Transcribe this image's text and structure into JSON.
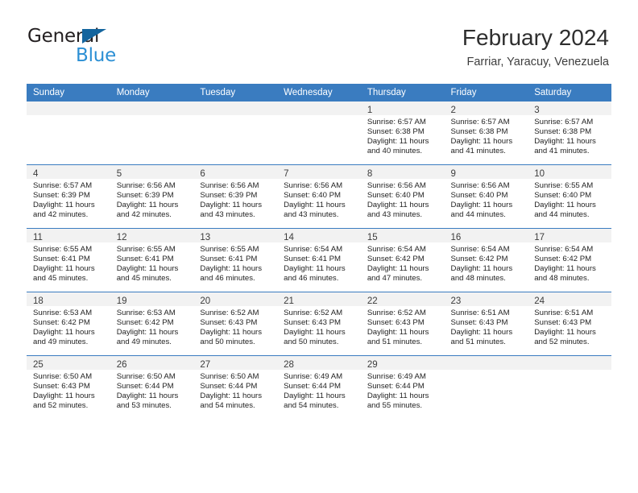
{
  "brand": {
    "line1": "General",
    "line2": "Blue",
    "triangle_color": "#14659e",
    "line2_color": "#2b8fd4"
  },
  "header": {
    "title": "February 2024",
    "location": "Farriar, Yaracuy, Venezuela"
  },
  "theme": {
    "header_row_bg": "#3a7cc0",
    "daynum_band_bg": "#f2f2f2",
    "week_separator": "#3a7cc0"
  },
  "weekdays": [
    "Sunday",
    "Monday",
    "Tuesday",
    "Wednesday",
    "Thursday",
    "Friday",
    "Saturday"
  ],
  "weeks": [
    [
      {
        "day": ""
      },
      {
        "day": ""
      },
      {
        "day": ""
      },
      {
        "day": ""
      },
      {
        "day": "1",
        "sunrise": "Sunrise: 6:57 AM",
        "sunset": "Sunset: 6:38 PM",
        "daylight1": "Daylight: 11 hours",
        "daylight2": "and 40 minutes."
      },
      {
        "day": "2",
        "sunrise": "Sunrise: 6:57 AM",
        "sunset": "Sunset: 6:38 PM",
        "daylight1": "Daylight: 11 hours",
        "daylight2": "and 41 minutes."
      },
      {
        "day": "3",
        "sunrise": "Sunrise: 6:57 AM",
        "sunset": "Sunset: 6:38 PM",
        "daylight1": "Daylight: 11 hours",
        "daylight2": "and 41 minutes."
      }
    ],
    [
      {
        "day": "4",
        "sunrise": "Sunrise: 6:57 AM",
        "sunset": "Sunset: 6:39 PM",
        "daylight1": "Daylight: 11 hours",
        "daylight2": "and 42 minutes."
      },
      {
        "day": "5",
        "sunrise": "Sunrise: 6:56 AM",
        "sunset": "Sunset: 6:39 PM",
        "daylight1": "Daylight: 11 hours",
        "daylight2": "and 42 minutes."
      },
      {
        "day": "6",
        "sunrise": "Sunrise: 6:56 AM",
        "sunset": "Sunset: 6:39 PM",
        "daylight1": "Daylight: 11 hours",
        "daylight2": "and 43 minutes."
      },
      {
        "day": "7",
        "sunrise": "Sunrise: 6:56 AM",
        "sunset": "Sunset: 6:40 PM",
        "daylight1": "Daylight: 11 hours",
        "daylight2": "and 43 minutes."
      },
      {
        "day": "8",
        "sunrise": "Sunrise: 6:56 AM",
        "sunset": "Sunset: 6:40 PM",
        "daylight1": "Daylight: 11 hours",
        "daylight2": "and 43 minutes."
      },
      {
        "day": "9",
        "sunrise": "Sunrise: 6:56 AM",
        "sunset": "Sunset: 6:40 PM",
        "daylight1": "Daylight: 11 hours",
        "daylight2": "and 44 minutes."
      },
      {
        "day": "10",
        "sunrise": "Sunrise: 6:55 AM",
        "sunset": "Sunset: 6:40 PM",
        "daylight1": "Daylight: 11 hours",
        "daylight2": "and 44 minutes."
      }
    ],
    [
      {
        "day": "11",
        "sunrise": "Sunrise: 6:55 AM",
        "sunset": "Sunset: 6:41 PM",
        "daylight1": "Daylight: 11 hours",
        "daylight2": "and 45 minutes."
      },
      {
        "day": "12",
        "sunrise": "Sunrise: 6:55 AM",
        "sunset": "Sunset: 6:41 PM",
        "daylight1": "Daylight: 11 hours",
        "daylight2": "and 45 minutes."
      },
      {
        "day": "13",
        "sunrise": "Sunrise: 6:55 AM",
        "sunset": "Sunset: 6:41 PM",
        "daylight1": "Daylight: 11 hours",
        "daylight2": "and 46 minutes."
      },
      {
        "day": "14",
        "sunrise": "Sunrise: 6:54 AM",
        "sunset": "Sunset: 6:41 PM",
        "daylight1": "Daylight: 11 hours",
        "daylight2": "and 46 minutes."
      },
      {
        "day": "15",
        "sunrise": "Sunrise: 6:54 AM",
        "sunset": "Sunset: 6:42 PM",
        "daylight1": "Daylight: 11 hours",
        "daylight2": "and 47 minutes."
      },
      {
        "day": "16",
        "sunrise": "Sunrise: 6:54 AM",
        "sunset": "Sunset: 6:42 PM",
        "daylight1": "Daylight: 11 hours",
        "daylight2": "and 48 minutes."
      },
      {
        "day": "17",
        "sunrise": "Sunrise: 6:54 AM",
        "sunset": "Sunset: 6:42 PM",
        "daylight1": "Daylight: 11 hours",
        "daylight2": "and 48 minutes."
      }
    ],
    [
      {
        "day": "18",
        "sunrise": "Sunrise: 6:53 AM",
        "sunset": "Sunset: 6:42 PM",
        "daylight1": "Daylight: 11 hours",
        "daylight2": "and 49 minutes."
      },
      {
        "day": "19",
        "sunrise": "Sunrise: 6:53 AM",
        "sunset": "Sunset: 6:42 PM",
        "daylight1": "Daylight: 11 hours",
        "daylight2": "and 49 minutes."
      },
      {
        "day": "20",
        "sunrise": "Sunrise: 6:52 AM",
        "sunset": "Sunset: 6:43 PM",
        "daylight1": "Daylight: 11 hours",
        "daylight2": "and 50 minutes."
      },
      {
        "day": "21",
        "sunrise": "Sunrise: 6:52 AM",
        "sunset": "Sunset: 6:43 PM",
        "daylight1": "Daylight: 11 hours",
        "daylight2": "and 50 minutes."
      },
      {
        "day": "22",
        "sunrise": "Sunrise: 6:52 AM",
        "sunset": "Sunset: 6:43 PM",
        "daylight1": "Daylight: 11 hours",
        "daylight2": "and 51 minutes."
      },
      {
        "day": "23",
        "sunrise": "Sunrise: 6:51 AM",
        "sunset": "Sunset: 6:43 PM",
        "daylight1": "Daylight: 11 hours",
        "daylight2": "and 51 minutes."
      },
      {
        "day": "24",
        "sunrise": "Sunrise: 6:51 AM",
        "sunset": "Sunset: 6:43 PM",
        "daylight1": "Daylight: 11 hours",
        "daylight2": "and 52 minutes."
      }
    ],
    [
      {
        "day": "25",
        "sunrise": "Sunrise: 6:50 AM",
        "sunset": "Sunset: 6:43 PM",
        "daylight1": "Daylight: 11 hours",
        "daylight2": "and 52 minutes."
      },
      {
        "day": "26",
        "sunrise": "Sunrise: 6:50 AM",
        "sunset": "Sunset: 6:44 PM",
        "daylight1": "Daylight: 11 hours",
        "daylight2": "and 53 minutes."
      },
      {
        "day": "27",
        "sunrise": "Sunrise: 6:50 AM",
        "sunset": "Sunset: 6:44 PM",
        "daylight1": "Daylight: 11 hours",
        "daylight2": "and 54 minutes."
      },
      {
        "day": "28",
        "sunrise": "Sunrise: 6:49 AM",
        "sunset": "Sunset: 6:44 PM",
        "daylight1": "Daylight: 11 hours",
        "daylight2": "and 54 minutes."
      },
      {
        "day": "29",
        "sunrise": "Sunrise: 6:49 AM",
        "sunset": "Sunset: 6:44 PM",
        "daylight1": "Daylight: 11 hours",
        "daylight2": "and 55 minutes."
      },
      {
        "day": ""
      },
      {
        "day": ""
      }
    ]
  ]
}
